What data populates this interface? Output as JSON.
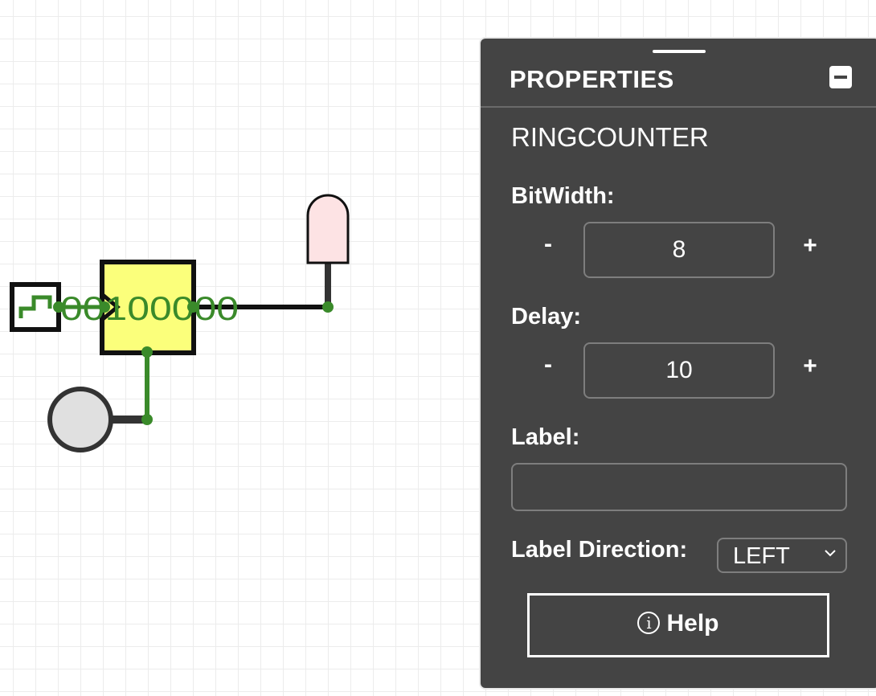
{
  "circuit": {
    "ring_counter_display": "00100000"
  },
  "panel": {
    "title": "PROPERTIES",
    "component_name": "RINGCOUNTER",
    "bitwidth": {
      "label": "BitWidth:",
      "value": "8",
      "decrement_label": "-",
      "increment_label": "+"
    },
    "delay": {
      "label": "Delay:",
      "value": "10",
      "decrement_label": "-",
      "increment_label": "+"
    },
    "label_field": {
      "label": "Label:",
      "value": ""
    },
    "label_direction": {
      "label": "Label Direction:",
      "value": "LEFT"
    },
    "help": {
      "icon": "i",
      "label": "Help"
    }
  },
  "colors": {
    "wire_green": "#3a8a2a",
    "ring_counter_fill": "#fbff7b",
    "led_fill": "#fde3e4",
    "panel_bg": "#444444",
    "button_fill": "#e0e0e0"
  }
}
